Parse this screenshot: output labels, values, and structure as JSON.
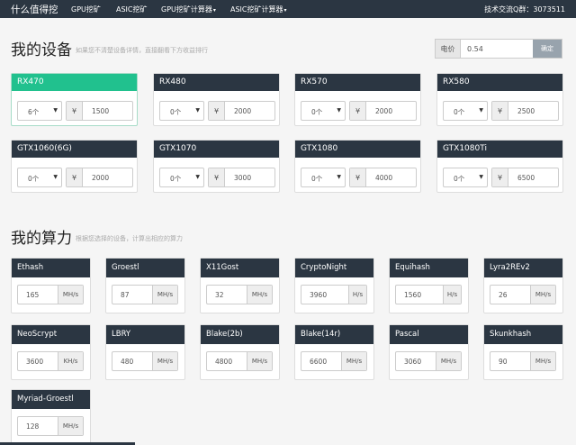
{
  "nav": {
    "brand": "什么值得挖",
    "items": [
      {
        "label": "GPU挖矿",
        "has_caret": false
      },
      {
        "label": "ASIC挖矿",
        "has_caret": false
      },
      {
        "label": "GPU挖矿计算器",
        "has_caret": true
      },
      {
        "label": "ASIC挖矿计算器",
        "has_caret": true
      }
    ],
    "contact": "技术交流Q群：3073511"
  },
  "devices_section": {
    "title": "我的设备",
    "subtitle": "如果您不清楚设备详情，直接翻看下方收益排行",
    "price": {
      "label": "电价",
      "value": "0.54",
      "button": "确定"
    }
  },
  "devices": [
    {
      "name": "RX470",
      "qty": "6个",
      "currency": "¥",
      "price": "1500",
      "active": true
    },
    {
      "name": "RX480",
      "qty": "0个",
      "currency": "¥",
      "price": "2000",
      "active": false
    },
    {
      "name": "RX570",
      "qty": "0个",
      "currency": "¥",
      "price": "2000",
      "active": false
    },
    {
      "name": "RX580",
      "qty": "0个",
      "currency": "¥",
      "price": "2500",
      "active": false
    },
    {
      "name": "GTX1060(6G)",
      "qty": "0个",
      "currency": "¥",
      "price": "2000",
      "active": false
    },
    {
      "name": "GTX1070",
      "qty": "0个",
      "currency": "¥",
      "price": "3000",
      "active": false
    },
    {
      "name": "GTX1080",
      "qty": "0个",
      "currency": "¥",
      "price": "4000",
      "active": false
    },
    {
      "name": "GTX1080Ti",
      "qty": "0个",
      "currency": "¥",
      "price": "6500",
      "active": false
    }
  ],
  "hash_section": {
    "title": "我的算力",
    "subtitle": "根据您选择的设备，计算出相应的算力"
  },
  "algorithms": [
    {
      "name": "Ethash",
      "value": "165",
      "unit": "MH/s"
    },
    {
      "name": "Groestl",
      "value": "87",
      "unit": "MH/s"
    },
    {
      "name": "X11Gost",
      "value": "32",
      "unit": "MH/s"
    },
    {
      "name": "CryptoNight",
      "value": "3960",
      "unit": "H/s"
    },
    {
      "name": "Equihash",
      "value": "1560",
      "unit": "H/s"
    },
    {
      "name": "Lyra2REv2",
      "value": "26",
      "unit": "MH/s"
    },
    {
      "name": "NeoScrypt",
      "value": "3600",
      "unit": "KH/s"
    },
    {
      "name": "LBRY",
      "value": "480",
      "unit": "MH/s"
    },
    {
      "name": "Blake(2b)",
      "value": "4800",
      "unit": "MH/s"
    },
    {
      "name": "Blake(14r)",
      "value": "6600",
      "unit": "MH/s"
    },
    {
      "name": "Pascal",
      "value": "3060",
      "unit": "MH/s"
    },
    {
      "name": "Skunkhash",
      "value": "90",
      "unit": "MH/s"
    },
    {
      "name": "Myriad-Groestl",
      "value": "128",
      "unit": "MH/s"
    }
  ],
  "colors": {
    "navbar": "#2b3642",
    "active_card": "#21c18e",
    "card_header": "#2b3642",
    "confirm_button": "#98a3ad"
  }
}
